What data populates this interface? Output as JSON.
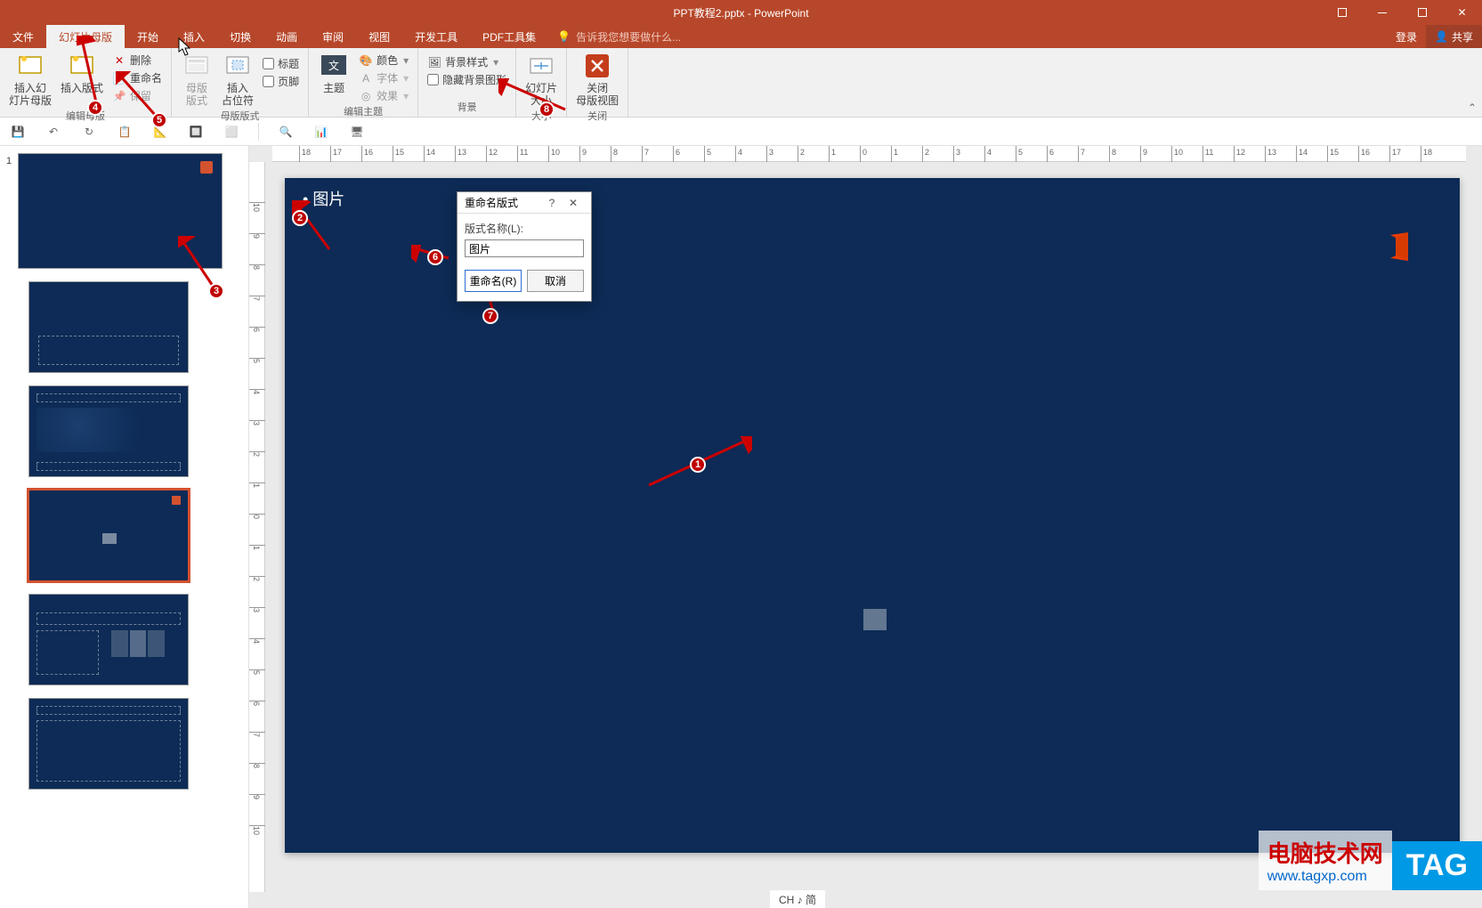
{
  "window": {
    "title": "PPT教程2.pptx - PowerPoint",
    "login": "登录",
    "share": "共享"
  },
  "tabs": {
    "file": "文件",
    "slideMaster": "幻灯片母版",
    "home": "开始",
    "insert": "插入",
    "transitions": "切换",
    "animations": "动画",
    "review": "审阅",
    "view": "视图",
    "devtools": "开发工具",
    "pdf": "PDF工具集",
    "tell": "告诉我您想要做什么..."
  },
  "ribbon": {
    "insertSlideMaster": "插入幻\n灯片母版",
    "insertLayout": "插入版式",
    "delete": "删除",
    "rename": "重命名",
    "preserve": "保留",
    "editMaster": "编辑母版",
    "masterLayout": "母版\n版式",
    "insertPlaceholder": "插入\n占位符",
    "title": "标题",
    "footers": "页脚",
    "masterLayoutGroup": "母版版式",
    "themes": "主题",
    "colors": "颜色",
    "fonts": "字体",
    "effects": "效果",
    "editTheme": "编辑主题",
    "bgStyles": "背景样式",
    "hideBg": "隐藏背景图形",
    "background": "背景",
    "slideSize": "幻灯片\n大小",
    "size": "大小",
    "closeMaster": "关闭\n母版视图",
    "close": "关闭"
  },
  "slide": {
    "picture": "图片"
  },
  "dialog": {
    "title": "重命名版式",
    "label": "版式名称(L):",
    "value": "图片",
    "rename": "重命名(R)",
    "cancel": "取消"
  },
  "markers": {
    "m1": "1",
    "m2": "2",
    "m3": "3",
    "m4": "4",
    "m5": "5",
    "m6": "6",
    "m7": "7",
    "m8": "8"
  },
  "watermark": {
    "line1": "电脑技术网",
    "line2": "www.tagxp.com",
    "tag": "TAG"
  },
  "status": {
    "ime": "CH ♪ 简"
  },
  "thumb": {
    "num1": "1"
  }
}
